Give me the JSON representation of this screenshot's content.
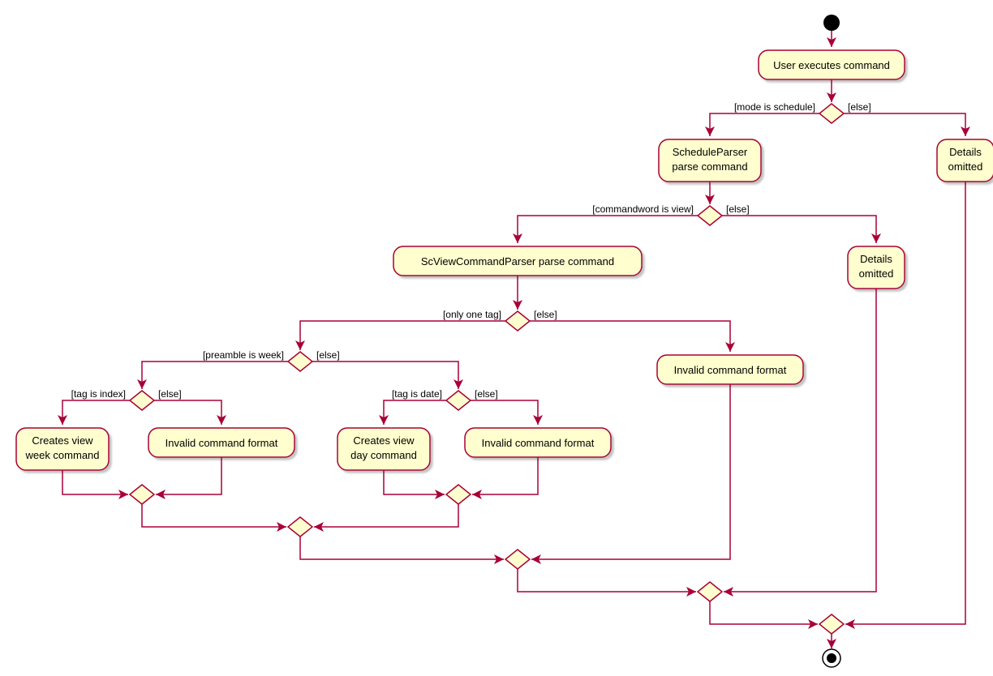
{
  "nodes": {
    "start": {
      "label": ""
    },
    "userExec": {
      "label": "User executes command"
    },
    "decisionMode": {
      "left": "[mode is schedule]",
      "right": "[else]"
    },
    "scheduleParser": {
      "line1": "ScheduleParser",
      "line2": "parse command"
    },
    "detailsOmitted1": {
      "line1": "Details",
      "line2": "omitted"
    },
    "decisionView": {
      "left": "[commandword is view]",
      "right": "[else]"
    },
    "scViewParser": {
      "label": "ScViewCommandParser parse command"
    },
    "detailsOmitted2": {
      "line1": "Details",
      "line2": "omitted"
    },
    "decisionTag": {
      "left": "[only one tag]",
      "right": "[else]"
    },
    "invalidFormat3": {
      "label": "Invalid command format"
    },
    "decisionPreamble": {
      "left": "[preamble is week]",
      "right": "[else]"
    },
    "decisionIndex": {
      "left": "[tag is index]",
      "right": "[else]"
    },
    "createsWeek": {
      "line1": "Creates view",
      "line2": "week command"
    },
    "invalidFormat1": {
      "label": "Invalid command format"
    },
    "decisionDate": {
      "left": "[tag is date]",
      "right": "[else]"
    },
    "createsDay": {
      "line1": "Creates view",
      "line2": "day command"
    },
    "invalidFormat2": {
      "label": "Invalid command format"
    }
  }
}
